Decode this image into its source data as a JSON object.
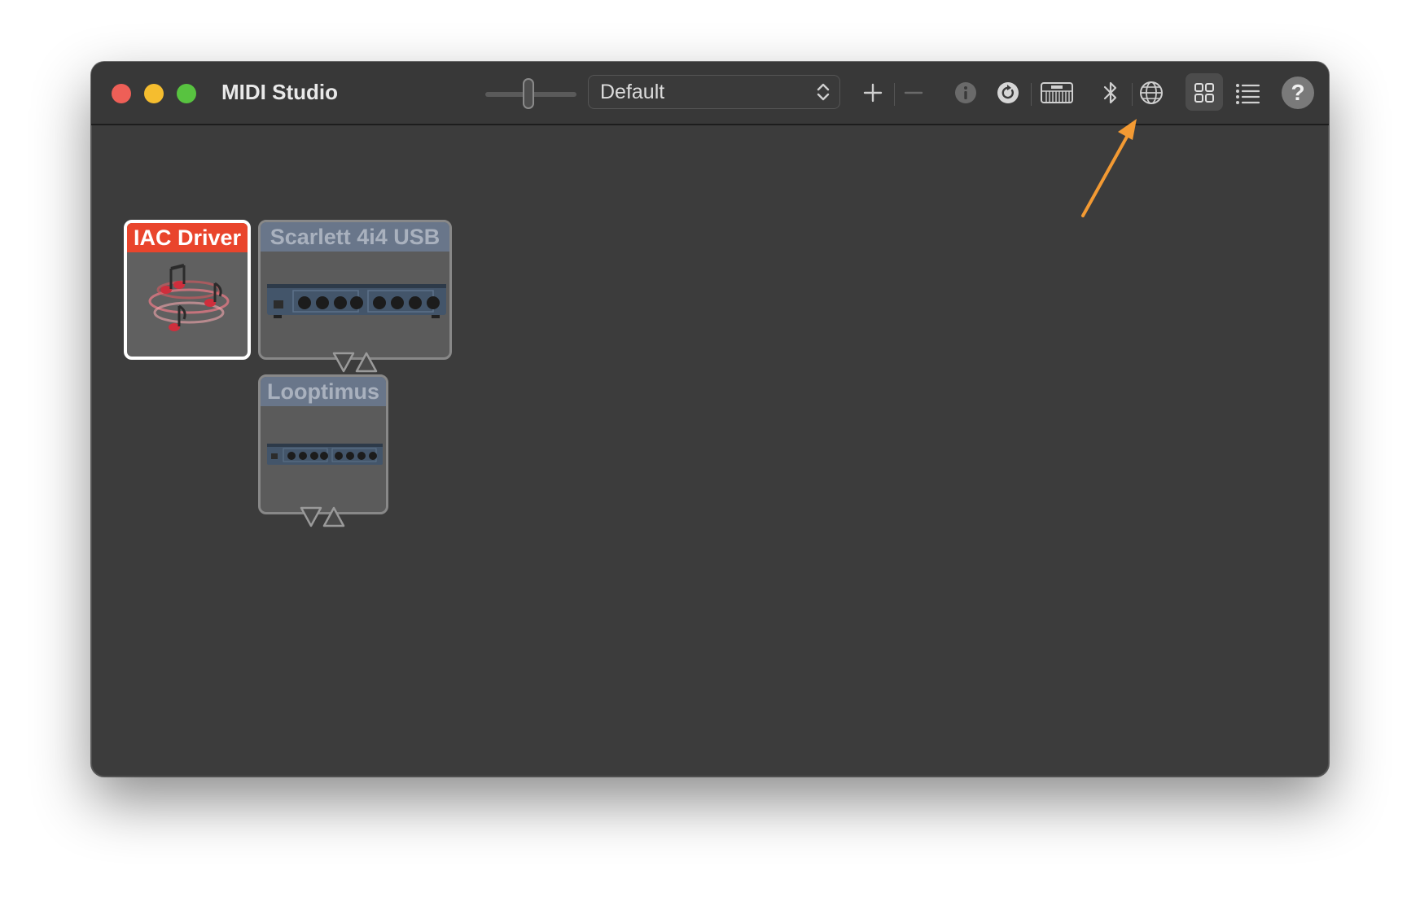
{
  "window": {
    "title": "MIDI Studio"
  },
  "toolbar": {
    "configuration": {
      "selected": "Default"
    },
    "buttons": {
      "add": "plus-icon",
      "remove": "minus-icon",
      "info": "info-icon",
      "rescan": "rescan-icon",
      "test_setup": "piano-keyboard-icon",
      "bluetooth": "bluetooth-icon",
      "network": "globe-icon",
      "icon_view": "grid-view-icon",
      "list_view": "list-view-icon",
      "help": "?"
    }
  },
  "devices": [
    {
      "name": "IAC Driver",
      "selected": true,
      "icon": "midi-notes-icon"
    },
    {
      "name": "Scarlett 4i4 USB",
      "selected": false,
      "icon": "audio-interface-icon"
    },
    {
      "name": "Looptimus",
      "selected": false,
      "icon": "audio-interface-icon"
    }
  ],
  "colors": {
    "window_bg": "#3c3c3c",
    "selected_header": "#e9452c",
    "offline_header": "#69768a",
    "annotation_arrow": "#f39a33"
  }
}
